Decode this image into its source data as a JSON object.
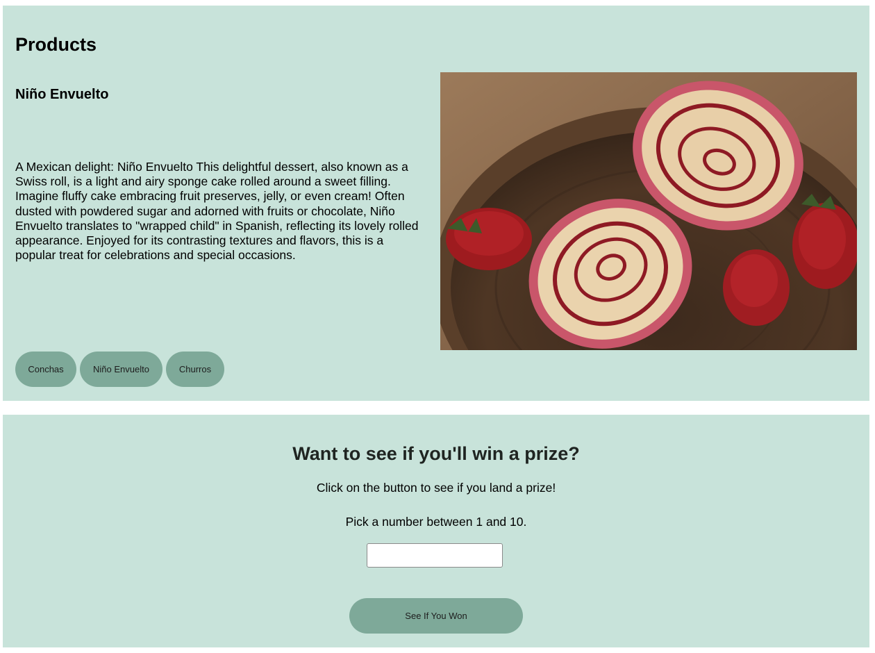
{
  "products": {
    "title": "Products",
    "product_name": "Niño Envuelto",
    "description": "A Mexican delight: Niño Envuelto This delightful dessert, also known as a Swiss roll, is a light and airy sponge cake rolled around a sweet filling. Imagine fluffy cake embracing fruit preserves, jelly, or even cream! Often dusted with powdered sugar and adorned with fruits or chocolate, Niño Envuelto translates to \"wrapped child\" in Spanish, reflecting its lovely rolled appearance. Enjoyed for its contrasting textures and flavors, this is a popular treat for celebrations and special occasions.",
    "tabs": [
      "Conchas",
      "Niño Envuelto",
      "Churros"
    ]
  },
  "prize": {
    "title": "Want to see if you'll win a prize?",
    "instruction": "Click on the button to see if you land a prize!",
    "pick_prompt": "Pick a number between 1 and 10.",
    "input_value": "",
    "button_label": "See If You Won"
  },
  "colors": {
    "panel_bg": "#c8e3da",
    "button_bg": "#7ea999"
  }
}
